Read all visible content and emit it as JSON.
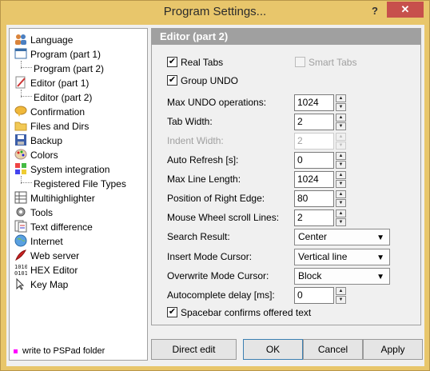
{
  "window": {
    "title": "Program Settings...",
    "help_label": "?",
    "close_label": "✕"
  },
  "sidebar": {
    "items": [
      {
        "label": "Language",
        "icon": "language-people-icon"
      },
      {
        "label": "Program  (part 1)",
        "icon": "program-window-icon"
      },
      {
        "label": "Program  (part 2)",
        "icon": "none"
      },
      {
        "label": "Editor  (part 1)",
        "icon": "editor-pencil-icon"
      },
      {
        "label": "Editor  (part 2)",
        "icon": "none",
        "selected": true
      },
      {
        "label": "Confirmation",
        "icon": "chat-bubble-icon"
      },
      {
        "label": "Files and Dirs",
        "icon": "folder-icon"
      },
      {
        "label": "Backup",
        "icon": "backup-disk-icon"
      },
      {
        "label": "Colors",
        "icon": "palette-icon"
      },
      {
        "label": "System integration",
        "icon": "windows-flag-icon"
      },
      {
        "label": "Registered File Types",
        "icon": "none"
      },
      {
        "label": "Multihighlighter",
        "icon": "grid-icon"
      },
      {
        "label": "Tools",
        "icon": "tools-gear-icon"
      },
      {
        "label": "Text difference",
        "icon": "text-diff-icon"
      },
      {
        "label": "Internet",
        "icon": "globe-icon"
      },
      {
        "label": "Web server",
        "icon": "feather-icon"
      },
      {
        "label": "HEX Editor",
        "icon": "binary-icon"
      },
      {
        "label": "Key Map",
        "icon": "keyboard-icon"
      }
    ],
    "legend": "write to PSPad folder"
  },
  "panel": {
    "header": "Editor  (part 2)",
    "real_tabs": {
      "label": "Real Tabs",
      "checked": true
    },
    "smart_tabs": {
      "label": "Smart Tabs",
      "checked": false,
      "disabled": true
    },
    "group_undo": {
      "label": "Group UNDO",
      "checked": true
    },
    "fields": [
      {
        "label": "Max UNDO operations:",
        "value": "1024"
      },
      {
        "label": "Tab Width:",
        "value": "2"
      },
      {
        "label": "Indent Width:",
        "value": "2",
        "disabled": true
      },
      {
        "label": "Auto Refresh [s]:",
        "value": "0"
      },
      {
        "label": "Max Line Length:",
        "value": "1024"
      },
      {
        "label": "Position of Right Edge:",
        "value": "80"
      },
      {
        "label": "Mouse Wheel scroll Lines:",
        "value": "2"
      }
    ],
    "selects": [
      {
        "label": "Search Result:",
        "value": "Center"
      },
      {
        "label": "Insert Mode Cursor:",
        "value": "Vertical line"
      },
      {
        "label": "Overwrite Mode Cursor:",
        "value": "Block"
      }
    ],
    "autocomplete": {
      "label": "Autocomplete delay [ms]:",
      "value": "0"
    },
    "spacebar": {
      "label": "Spacebar confirms offered text",
      "checked": true
    },
    "check_mark": "✔",
    "spin_up": "▲",
    "spin_down": "▼",
    "dropdown_arrow": "▼"
  },
  "buttons": {
    "direct_edit": "Direct edit",
    "ok": "OK",
    "cancel": "Cancel",
    "apply": "Apply"
  },
  "colors": {
    "title_bar": "#e8c66b",
    "close_button": "#c7504c",
    "panel_header": "#a0a0a0",
    "legend_marker": "#ff00ff"
  }
}
